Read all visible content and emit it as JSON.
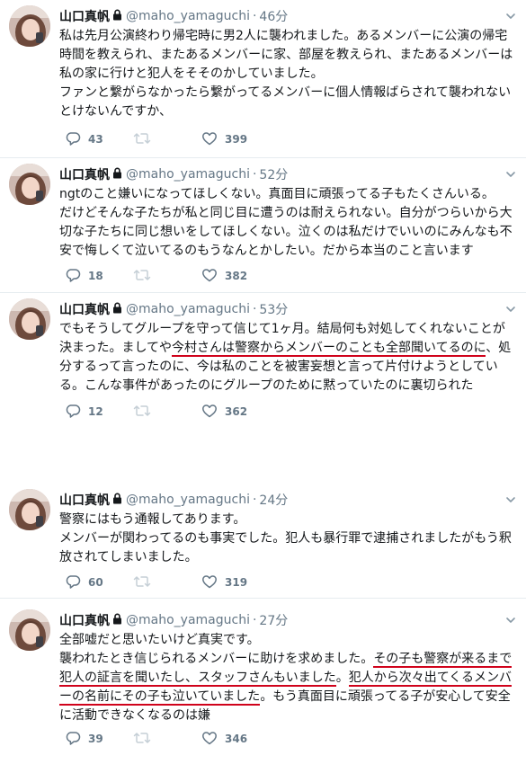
{
  "colors": {
    "accent_underline": "#d0021b",
    "meta_gray": "#657786",
    "text": "#14171a"
  },
  "tweets": [
    {
      "name": "山口真帆",
      "handle": "@maho_yamaguchi",
      "separator": "·",
      "time": "46分",
      "lines": [
        [
          "私は先月公演終わり帰宅時に男2人に襲われました。あるメンバーに公演の帰宅"
        ],
        [
          "時間を教えられ、またあるメンバーに家、部屋を教えられ、またあるメンバーは"
        ],
        [
          "私の家に行けと犯人をそそのかしていました。"
        ],
        [
          "ファンと繋がらなかったら繋がってるメンバーに個人情報ばらされて襲われない"
        ],
        [
          "とけないんですか、"
        ]
      ],
      "replies": "43",
      "retweets": "",
      "likes": "399"
    },
    {
      "name": "山口真帆",
      "handle": "@maho_yamaguchi",
      "separator": "·",
      "time": "52分",
      "lines": [
        [
          "ngtのこと嫌いになってほしくない。真面目に頑張ってる子もたくさんいる。"
        ],
        [
          "だけどそんな子たちが私と同じ目に遭うのは耐えられない。自分がつらいから大"
        ],
        [
          "切な子たちに同じ想いをしてほしくない。泣くのは私だけでいいのにみんなも不"
        ],
        [
          "安で悔しくて泣いてるのもうなんとかしたい。だから本当のこと言います"
        ]
      ],
      "replies": "18",
      "retweets": "",
      "likes": "382"
    },
    {
      "name": "山口真帆",
      "handle": "@maho_yamaguchi",
      "separator": "·",
      "time": "53分",
      "lines": [
        [
          "でもそうしてグループを守って信じて1ヶ月。結局何も対処してくれないことが"
        ],
        [
          "決まった。ましてや",
          "今村さんは警察からメンバーのことも全部聞いてるのに",
          "、処"
        ],
        [
          "分するって言ったのに、今は私のことを被害妄想と言って片付けようとしてい"
        ],
        [
          "る。こんな事件があったのにグループのために黙っていたのに裏切られた"
        ]
      ],
      "replies": "12",
      "retweets": "",
      "likes": "362"
    },
    {
      "name": "山口真帆",
      "handle": "@maho_yamaguchi",
      "separator": "·",
      "time": "24分",
      "lines": [
        [
          "警察にはもう通報してあります。"
        ],
        [
          "メンバーが関わってるのも事実でした。犯人も暴行罪で逮捕されましたがもう釈"
        ],
        [
          "放されてしまいました。"
        ]
      ],
      "replies": "60",
      "retweets": "",
      "likes": "319"
    },
    {
      "name": "山口真帆",
      "handle": "@maho_yamaguchi",
      "separator": "·",
      "time": "27分",
      "lines": [
        [
          "全部嘘だと思いたいけど真実です。"
        ],
        [
          "襲われたとき信じられるメンバーに助けを求めました。",
          "その子も警察が来るまで"
        ],
        [
          "犯人の証言を聞いたし、スタッフさんもいました",
          "。",
          "犯人から次々出てくるメンバ"
        ],
        [
          "ーの名前にその子も泣いていました",
          "。もう真面目に頑張ってる子が安心して安全"
        ],
        [
          "に活動できなくなるのは嫌"
        ]
      ],
      "replies": "39",
      "retweets": "",
      "likes": "346"
    }
  ]
}
